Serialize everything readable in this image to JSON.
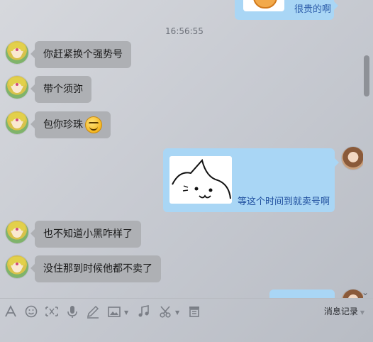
{
  "messages": {
    "top_right_text": "很贵的啊",
    "timestamp": "16:56:55",
    "left_1": "你赶紧换个强势号",
    "left_2": "带个须弥",
    "left_3": "包你珍珠",
    "right_image_caption": "等这个时间到就卖号啊",
    "left_4": "也不知道小黑咋样了",
    "left_5": "没住那到时候他都不卖了"
  },
  "toolbar": {
    "icons": [
      "font-icon",
      "emoji-icon",
      "screenshot-icon",
      "voice-icon",
      "pen-icon",
      "image-icon",
      "music-icon",
      "scissors-icon",
      "file-icon"
    ],
    "history_label": "消息记录"
  },
  "colors": {
    "left_bubble": "#aeb0b4",
    "right_bubble": "#a9d6f5",
    "icon": "#7a7e86"
  }
}
